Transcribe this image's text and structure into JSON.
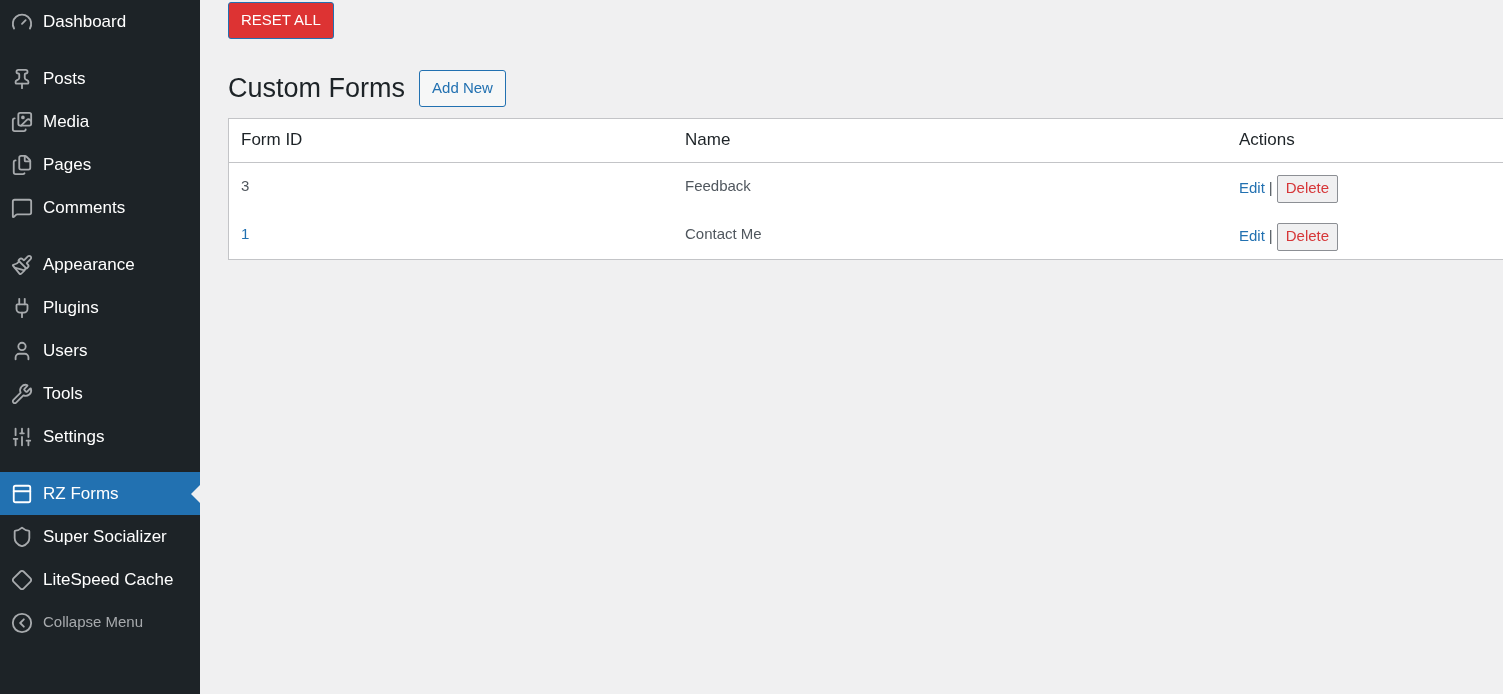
{
  "sidebar": {
    "groups": [
      {
        "items": [
          {
            "label": "Dashboard",
            "selected": false
          }
        ]
      },
      {
        "items": [
          {
            "label": "Posts",
            "selected": false
          },
          {
            "label": "Media",
            "selected": false
          },
          {
            "label": "Pages",
            "selected": false
          },
          {
            "label": "Comments",
            "selected": false
          }
        ]
      },
      {
        "items": [
          {
            "label": "Appearance",
            "selected": false
          },
          {
            "label": "Plugins",
            "selected": false
          },
          {
            "label": "Users",
            "selected": false
          },
          {
            "label": "Tools",
            "selected": false
          },
          {
            "label": "Settings",
            "selected": false
          }
        ]
      },
      {
        "items": [
          {
            "label": "RZ Forms",
            "selected": true
          },
          {
            "label": "Super Socializer",
            "selected": false
          },
          {
            "label": "LiteSpeed Cache",
            "selected": false
          }
        ]
      }
    ],
    "collapse": "Collapse Menu"
  },
  "reset_button": "RESET ALL",
  "heading": "Custom Forms",
  "add_new_button": "Add New",
  "table": {
    "columns": [
      "Form ID",
      "Name",
      "Actions"
    ],
    "rows": [
      {
        "id": "3",
        "id_link": false,
        "name": "Feedback",
        "edit": "Edit",
        "separator": "|",
        "delete": "Delete"
      },
      {
        "id": "1",
        "id_link": true,
        "name": "Contact Me",
        "edit": "Edit",
        "separator": "|",
        "delete": "Delete"
      }
    ]
  }
}
